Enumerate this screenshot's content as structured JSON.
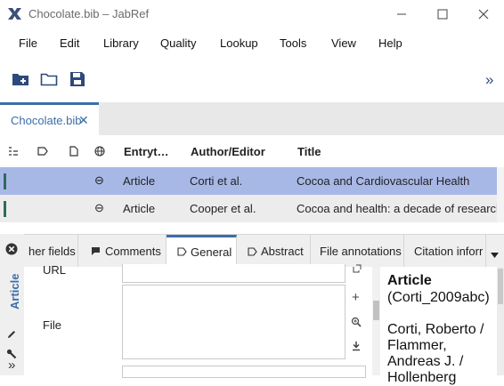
{
  "window": {
    "title": "Chocolate.bib – JabRef",
    "minimize_glyph": "—",
    "maximize_glyph": "☐",
    "close_glyph": "✕"
  },
  "menu": [
    "File",
    "Edit",
    "Library",
    "Quality",
    "Lookup",
    "Tools",
    "View",
    "Help"
  ],
  "toolbar": {
    "overflow_glyph": "»"
  },
  "library_tab": {
    "label": "Chocolate.bib",
    "close_glyph": "✕"
  },
  "table": {
    "columns": [
      "Entryt…",
      "Author/Editor",
      "Title"
    ],
    "rows": [
      {
        "link_glyph": "⊖",
        "type": "Article",
        "author": "Corti et al.",
        "title": "Cocoa and Cardiovascular Health"
      },
      {
        "link_glyph": "⊖",
        "type": "Article",
        "author": "Cooper et al.",
        "title": "Cocoa and health: a decade of research BP"
      }
    ]
  },
  "editor": {
    "vertical_label": "Article",
    "tabs": [
      "her fields",
      "Comments",
      "General",
      "Abstract",
      "File annotations",
      "Citation inforr"
    ],
    "active_tab": "General",
    "fields": {
      "url_label": "URL",
      "file_label": "File"
    },
    "strip_glyphs": {
      "close": "×",
      "edit": "✎",
      "tools": "🔧",
      "more": "»"
    },
    "side_glyphs": {
      "add": "+",
      "download": "⤓"
    }
  },
  "preview": {
    "type": "Article",
    "key": "(Corti_2009abc)",
    "authors_line1": "Corti, Roberto /",
    "authors_line2": "Flammer,",
    "authors_line3": "Andreas J. /",
    "authors_line4": "Hollenberg"
  },
  "colors": {
    "accent": "#3c6ea8",
    "selection": "#a8b8e6",
    "marker": "#2f6b5b"
  }
}
